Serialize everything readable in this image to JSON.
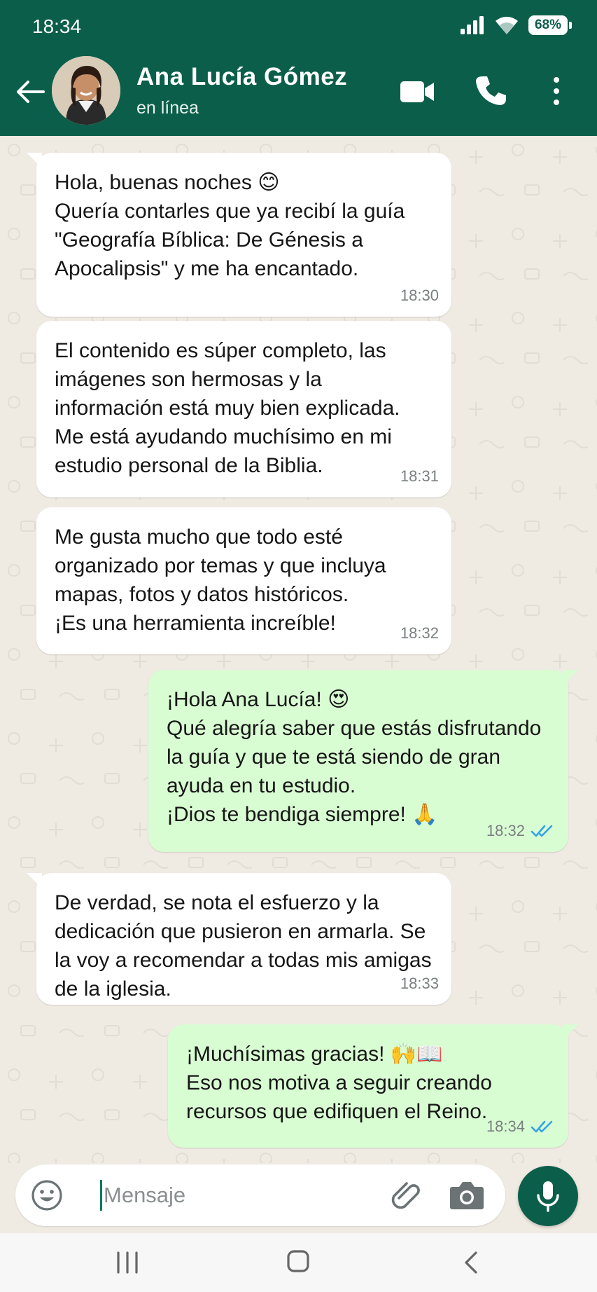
{
  "status_bar": {
    "time": "18:34",
    "battery": "68%"
  },
  "header": {
    "contact_name": "Ana Lucía Gómez",
    "contact_status": "en línea"
  },
  "messages": [
    {
      "dir": "in",
      "text": "Hola, buenas noches 😊\nQuería contarles que ya recibí la guía \"Geografía Bíblica: De Génesis a Apocalipsis\" y me ha encantado.",
      "time": "18:30"
    },
    {
      "dir": "in",
      "text": "El contenido es súper completo, las imágenes son hermosas y la información está muy bien explicada. Me está ayudando muchísimo en mi estudio personal de la Biblia.",
      "time": "18:31"
    },
    {
      "dir": "in",
      "text": "Me gusta mucho que todo esté organizado por temas y que incluya mapas, fotos y datos históricos.\n¡Es una herramienta increíble!",
      "time": "18:32"
    },
    {
      "dir": "out",
      "text": "¡Hola Ana Lucía! 😍\nQué alegría saber que estás disfrutando la guía y que te está siendo de gran ayuda en tu estudio.\n¡Dios te bendiga siempre! 🙏",
      "time": "18:32",
      "status": "read"
    },
    {
      "dir": "in",
      "text": "De verdad, se nota el esfuerzo y la dedicación que pusieron en armarla. Se la voy a recomendar a todas mis amigas de la iglesia.",
      "time": "18:33"
    },
    {
      "dir": "out",
      "text": "¡Muchísimas gracias! 🙌📖\nEso nos motiva a seguir creando recursos que edifiquen el Reino.",
      "time": "18:34",
      "status": "read"
    }
  ],
  "input": {
    "placeholder": "Mensaje",
    "value": ""
  },
  "icons": {
    "back": "arrow-left-icon",
    "video": "video-camera-icon",
    "call": "phone-icon",
    "menu": "more-vertical-icon",
    "emoji": "emoji-icon",
    "attach": "paperclip-icon",
    "camera": "camera-icon",
    "mic": "microphone-icon",
    "read_receipt": "double-check-icon"
  },
  "colors": {
    "header": "#0b5e4a",
    "incoming_bubble": "#ffffff",
    "outgoing_bubble": "#d9fdd3",
    "read_check": "#34a3e8",
    "chat_background": "#efeae2"
  }
}
